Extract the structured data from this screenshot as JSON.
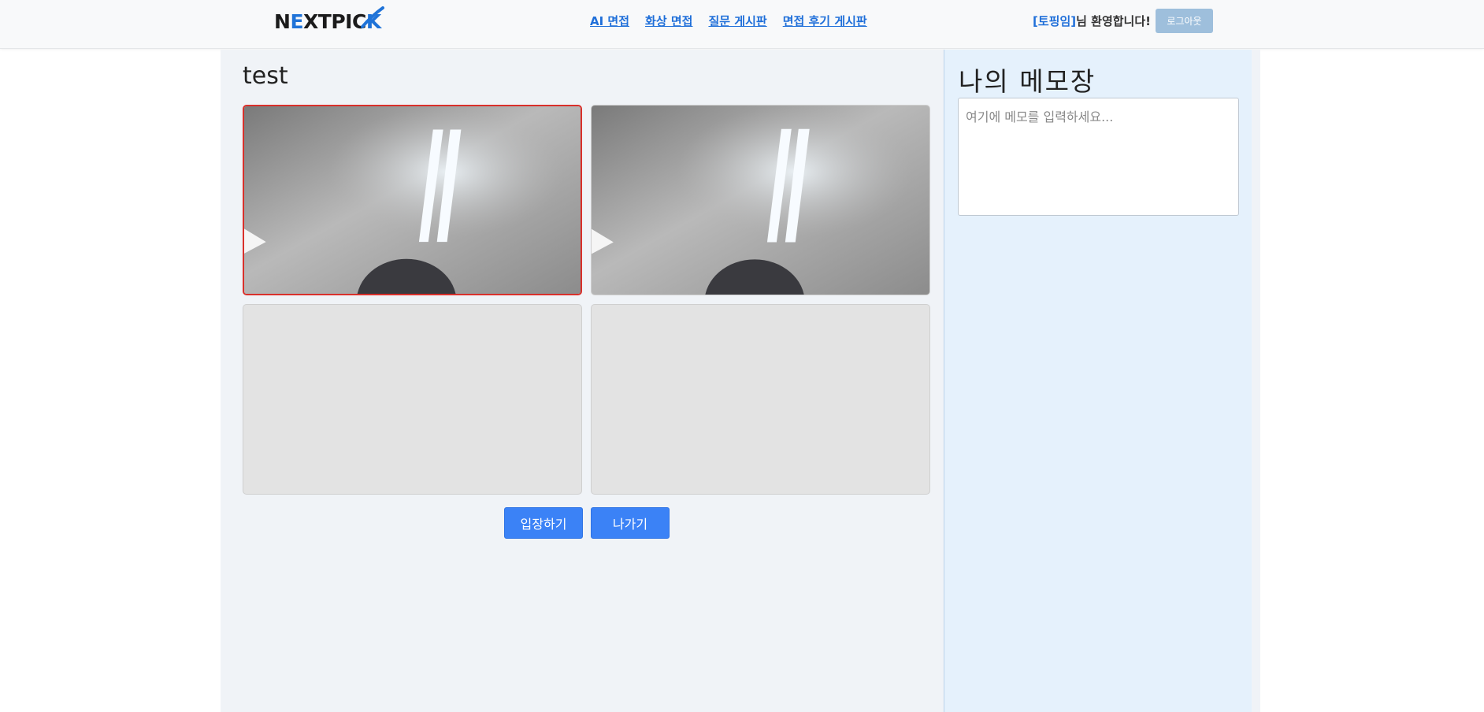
{
  "header": {
    "logo_text": "NEXTPICK",
    "nav": [
      {
        "label": "AI 면접"
      },
      {
        "label": "화상 면접"
      },
      {
        "label": "질문 게시판"
      },
      {
        "label": "면접 후기 게시판"
      }
    ],
    "username": "[토핑임]",
    "welcome_suffix": "님 환영합니다!",
    "logout_label": "로그아웃"
  },
  "room": {
    "title": "test",
    "tiles": [
      {
        "state": "video",
        "active": true
      },
      {
        "state": "video",
        "active": false
      },
      {
        "state": "empty",
        "active": false
      },
      {
        "state": "empty",
        "active": false
      }
    ],
    "enter_label": "입장하기",
    "exit_label": "나가기"
  },
  "memo": {
    "title": "나의 메모장",
    "placeholder": "여기에 메모를 입력하세요...",
    "value": ""
  },
  "colors": {
    "accent": "#3b82f6",
    "link": "#1f6fd9",
    "active_tile_border": "#d9302b",
    "memo_bg": "#e5f1fc",
    "main_bg": "#f0f3f7"
  }
}
